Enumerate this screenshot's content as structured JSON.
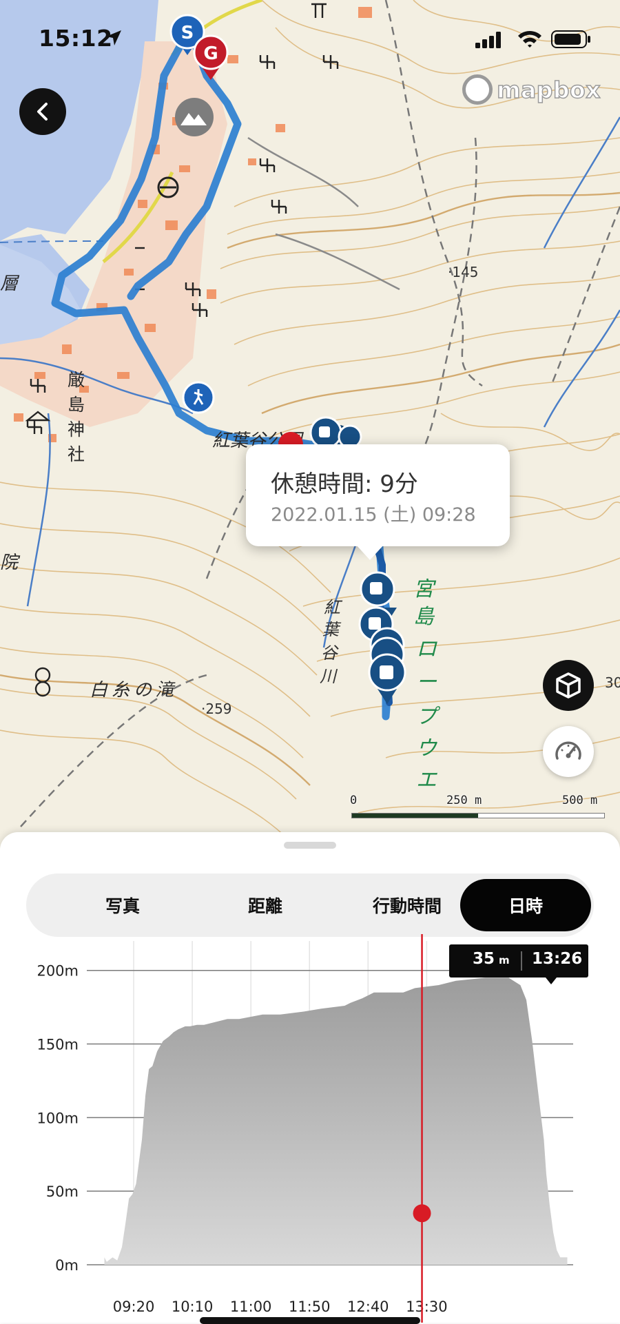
{
  "status_bar": {
    "time": "15:12"
  },
  "map": {
    "attribution": "mapbox",
    "labels": {
      "shrine": "厳島神社",
      "park": "紅葉谷公園",
      "ropeway": "宮島ロープウエ",
      "waterfall": "白糸の滝",
      "valley": "紅葉谷川",
      "temple": "院",
      "elev_145": "145",
      "elev_259": "259",
      "edge_num": "30"
    },
    "markers": {
      "start": "S",
      "goal": "G"
    },
    "popup": {
      "title": "休憩時間: 9分",
      "subtitle": "2022.01.15 (土) 09:28"
    },
    "scale": {
      "zero": "0",
      "mid": "250 m",
      "max": "500 m"
    },
    "buttons": {
      "three_d": "3d-view-button",
      "speed": "speed-button"
    }
  },
  "sheet": {
    "tabs": [
      {
        "label": "写真",
        "active": false
      },
      {
        "label": "距離",
        "active": false
      },
      {
        "label": "行動時間",
        "active": false
      },
      {
        "label": "日時",
        "active": true
      }
    ],
    "tooltip": {
      "altitude": "35",
      "unit": "m",
      "time": "13:26"
    }
  },
  "chart_data": {
    "type": "area",
    "xlabel": "",
    "ylabel": "",
    "x_ticks": [
      "09:20",
      "10:10",
      "11:00",
      "11:50",
      "12:40",
      "13:30"
    ],
    "y_ticks": [
      "0m",
      "50m",
      "100m",
      "150m",
      "200m"
    ],
    "ylim": [
      0,
      220
    ],
    "x_minutes": [
      535,
      537,
      542,
      546,
      550,
      553,
      556,
      559,
      562,
      567,
      570,
      573,
      576,
      580,
      585,
      590,
      594,
      598,
      604,
      608,
      614,
      620,
      640,
      650,
      670,
      685,
      705,
      720,
      740,
      745,
      755,
      765,
      790,
      800,
      820,
      835,
      860,
      880,
      890,
      895,
      900,
      905,
      910,
      912,
      915,
      918,
      921,
      924,
      930
    ],
    "altitude_m": [
      5,
      2,
      5,
      3,
      12,
      28,
      45,
      48,
      55,
      85,
      115,
      133,
      135,
      145,
      152,
      155,
      158,
      160,
      162,
      162,
      163,
      163,
      167,
      167,
      170,
      170,
      172,
      174,
      176,
      178,
      181,
      185,
      185,
      188,
      190,
      193,
      195,
      195,
      190,
      180,
      152,
      118,
      85,
      62,
      40,
      22,
      10,
      5,
      5
    ],
    "series": [
      {
        "values": []
      }
    ],
    "cursor": {
      "time": "13:26",
      "altitude": 35
    },
    "grid": true,
    "fill": "#b9b9b9",
    "cursor_color": "#d81b25"
  }
}
